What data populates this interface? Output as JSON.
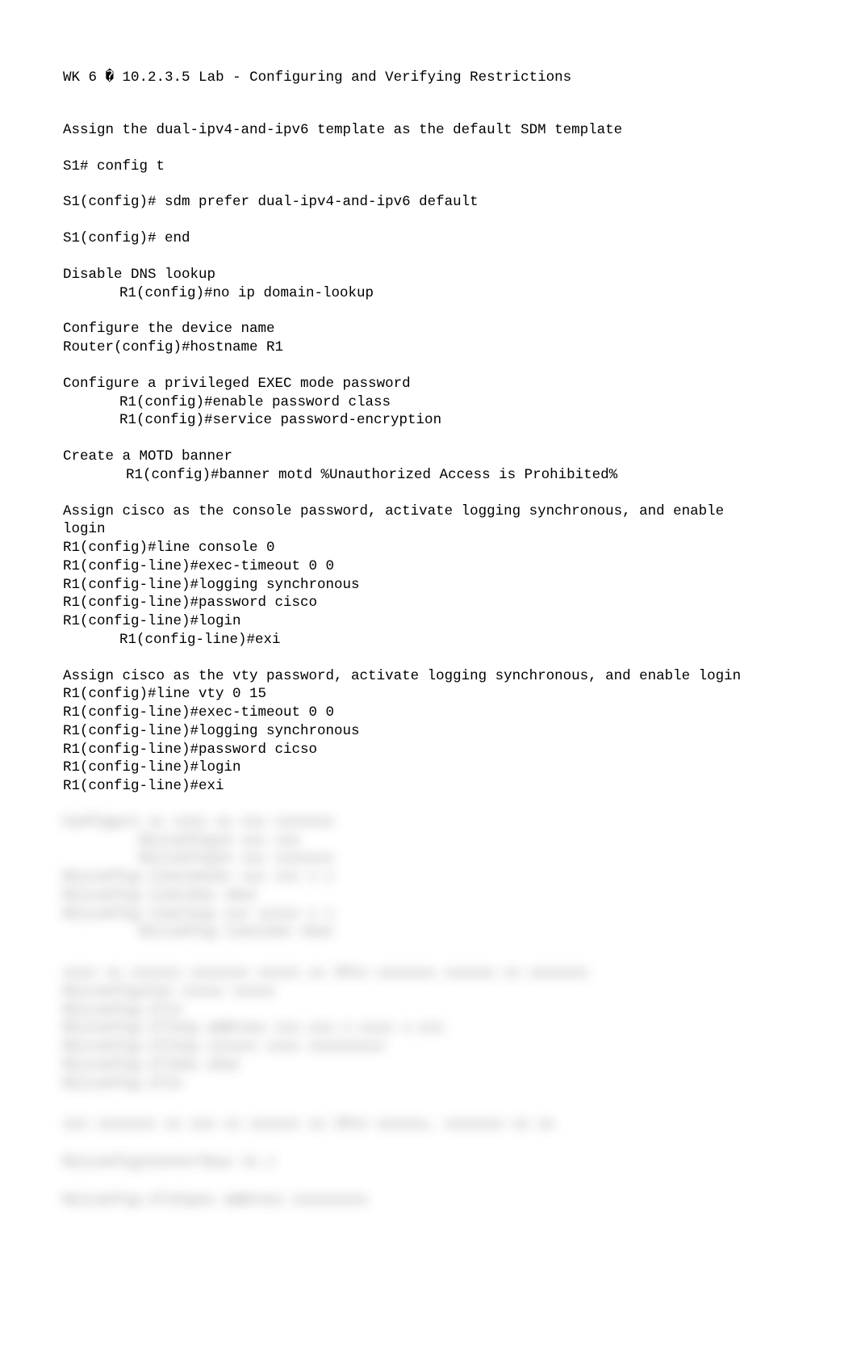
{
  "title": "WK 6 � 10.2.3.5 Lab - Configuring and Verifying Restrictions",
  "section1": {
    "heading": "Assign the dual-ipv4-and-ipv6 template as the default SDM template",
    "lines": [
      "S1# config t",
      "S1(config)# sdm prefer dual-ipv4-and-ipv6 default",
      "S1(config)# end"
    ]
  },
  "section2": {
    "heading": "Disable DNS lookup",
    "indented": "R1(config)#no ip domain-lookup"
  },
  "section3": {
    "heading": "Configure the device name",
    "line": "Router(config)#hostname R1"
  },
  "section4": {
    "heading": "Configure a privileged EXEC mode password",
    "indented1": "R1(config)#enable password class",
    "indented2": "R1(config)#service password-encryption"
  },
  "section5": {
    "heading": "Create a MOTD banner",
    "indented": "R1(config)#banner motd %Unauthorized Access is Prohibited%"
  },
  "section6": {
    "heading1": "Assign cisco as the console password, activate logging synchronous, and enable",
    "heading2": "login",
    "lines": [
      "R1(config)#line console 0",
      "R1(config-line)#exec-timeout 0 0",
      "R1(config-line)#logging synchronous",
      "R1(config-line)#password cisco",
      "R1(config-line)#login"
    ],
    "indented": "R1(config-line)#exi"
  },
  "section7": {
    "heading": "Assign cisco as the vty password, activate logging synchronous, and enable login",
    "lines": [
      "R1(config)#line vty 0 15",
      "R1(config-line)#exec-timeout 0 0",
      "R1(config-line)#logging synchronous",
      "R1(config-line)#password cicso",
      "R1(config-line)#login",
      "R1(config-line)#exi"
    ]
  },
  "blurred1": {
    "lines": [
      "Configure xx xxxx xx xxx xxxxxxx",
      "         R1(config)# xxx xxx",
      "         R1(config)# xxx xxxxxxx",
      "R1(config-line)#exec xxx xxx x x",
      "R1(config-line)#no shut",
      "R1(config-line)#ip xxx xxxxx x x",
      "         R1(config-line)#no shut"
    ]
  },
  "blurred2": {
    "lines": [
      "xxxx xx xxxxxx xxxxxxx xxxxx xx IPvx xxxxxxx xxxxxx xx xxxxxxx",
      "R1(config)#in xxxxx xxxxx",
      "R1(config-if)#",
      "R1(config-if)#ip address xxx.xxx.x.xxxx x.xxx",
      "R1(config-if)#ip xxxxxx xxxx xxxxxxxxx",
      "R1(config-if)#no shut",
      "R1(config-if)#"
    ]
  },
  "blurred3": {
    "line": "xxx xxxxxxx xx xxx xx xxxxxx xx IPvx xxxxxx, xxxxxxx xx xx"
  },
  "blurred4": {
    "line": "R1(config)#interface lo x"
  },
  "blurred5": {
    "line": "R1(config-if)#ipvx address xxxxxxxxx"
  }
}
